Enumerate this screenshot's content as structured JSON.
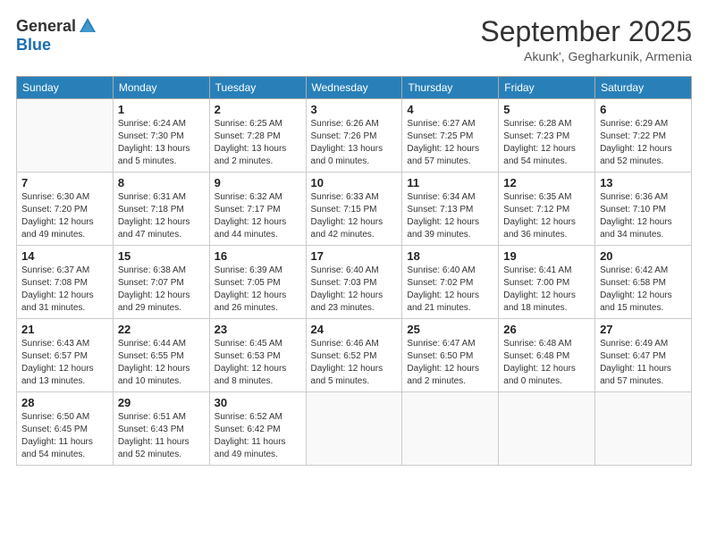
{
  "header": {
    "logo_general": "General",
    "logo_blue": "Blue",
    "month_title": "September 2025",
    "location": "Akunk', Gegharkunik, Armenia"
  },
  "days_of_week": [
    "Sunday",
    "Monday",
    "Tuesday",
    "Wednesday",
    "Thursday",
    "Friday",
    "Saturday"
  ],
  "weeks": [
    [
      {
        "day": "",
        "detail": ""
      },
      {
        "day": "1",
        "detail": "Sunrise: 6:24 AM\nSunset: 7:30 PM\nDaylight: 13 hours\nand 5 minutes."
      },
      {
        "day": "2",
        "detail": "Sunrise: 6:25 AM\nSunset: 7:28 PM\nDaylight: 13 hours\nand 2 minutes."
      },
      {
        "day": "3",
        "detail": "Sunrise: 6:26 AM\nSunset: 7:26 PM\nDaylight: 13 hours\nand 0 minutes."
      },
      {
        "day": "4",
        "detail": "Sunrise: 6:27 AM\nSunset: 7:25 PM\nDaylight: 12 hours\nand 57 minutes."
      },
      {
        "day": "5",
        "detail": "Sunrise: 6:28 AM\nSunset: 7:23 PM\nDaylight: 12 hours\nand 54 minutes."
      },
      {
        "day": "6",
        "detail": "Sunrise: 6:29 AM\nSunset: 7:22 PM\nDaylight: 12 hours\nand 52 minutes."
      }
    ],
    [
      {
        "day": "7",
        "detail": "Sunrise: 6:30 AM\nSunset: 7:20 PM\nDaylight: 12 hours\nand 49 minutes."
      },
      {
        "day": "8",
        "detail": "Sunrise: 6:31 AM\nSunset: 7:18 PM\nDaylight: 12 hours\nand 47 minutes."
      },
      {
        "day": "9",
        "detail": "Sunrise: 6:32 AM\nSunset: 7:17 PM\nDaylight: 12 hours\nand 44 minutes."
      },
      {
        "day": "10",
        "detail": "Sunrise: 6:33 AM\nSunset: 7:15 PM\nDaylight: 12 hours\nand 42 minutes."
      },
      {
        "day": "11",
        "detail": "Sunrise: 6:34 AM\nSunset: 7:13 PM\nDaylight: 12 hours\nand 39 minutes."
      },
      {
        "day": "12",
        "detail": "Sunrise: 6:35 AM\nSunset: 7:12 PM\nDaylight: 12 hours\nand 36 minutes."
      },
      {
        "day": "13",
        "detail": "Sunrise: 6:36 AM\nSunset: 7:10 PM\nDaylight: 12 hours\nand 34 minutes."
      }
    ],
    [
      {
        "day": "14",
        "detail": "Sunrise: 6:37 AM\nSunset: 7:08 PM\nDaylight: 12 hours\nand 31 minutes."
      },
      {
        "day": "15",
        "detail": "Sunrise: 6:38 AM\nSunset: 7:07 PM\nDaylight: 12 hours\nand 29 minutes."
      },
      {
        "day": "16",
        "detail": "Sunrise: 6:39 AM\nSunset: 7:05 PM\nDaylight: 12 hours\nand 26 minutes."
      },
      {
        "day": "17",
        "detail": "Sunrise: 6:40 AM\nSunset: 7:03 PM\nDaylight: 12 hours\nand 23 minutes."
      },
      {
        "day": "18",
        "detail": "Sunrise: 6:40 AM\nSunset: 7:02 PM\nDaylight: 12 hours\nand 21 minutes."
      },
      {
        "day": "19",
        "detail": "Sunrise: 6:41 AM\nSunset: 7:00 PM\nDaylight: 12 hours\nand 18 minutes."
      },
      {
        "day": "20",
        "detail": "Sunrise: 6:42 AM\nSunset: 6:58 PM\nDaylight: 12 hours\nand 15 minutes."
      }
    ],
    [
      {
        "day": "21",
        "detail": "Sunrise: 6:43 AM\nSunset: 6:57 PM\nDaylight: 12 hours\nand 13 minutes."
      },
      {
        "day": "22",
        "detail": "Sunrise: 6:44 AM\nSunset: 6:55 PM\nDaylight: 12 hours\nand 10 minutes."
      },
      {
        "day": "23",
        "detail": "Sunrise: 6:45 AM\nSunset: 6:53 PM\nDaylight: 12 hours\nand 8 minutes."
      },
      {
        "day": "24",
        "detail": "Sunrise: 6:46 AM\nSunset: 6:52 PM\nDaylight: 12 hours\nand 5 minutes."
      },
      {
        "day": "25",
        "detail": "Sunrise: 6:47 AM\nSunset: 6:50 PM\nDaylight: 12 hours\nand 2 minutes."
      },
      {
        "day": "26",
        "detail": "Sunrise: 6:48 AM\nSunset: 6:48 PM\nDaylight: 12 hours\nand 0 minutes."
      },
      {
        "day": "27",
        "detail": "Sunrise: 6:49 AM\nSunset: 6:47 PM\nDaylight: 11 hours\nand 57 minutes."
      }
    ],
    [
      {
        "day": "28",
        "detail": "Sunrise: 6:50 AM\nSunset: 6:45 PM\nDaylight: 11 hours\nand 54 minutes."
      },
      {
        "day": "29",
        "detail": "Sunrise: 6:51 AM\nSunset: 6:43 PM\nDaylight: 11 hours\nand 52 minutes."
      },
      {
        "day": "30",
        "detail": "Sunrise: 6:52 AM\nSunset: 6:42 PM\nDaylight: 11 hours\nand 49 minutes."
      },
      {
        "day": "",
        "detail": ""
      },
      {
        "day": "",
        "detail": ""
      },
      {
        "day": "",
        "detail": ""
      },
      {
        "day": "",
        "detail": ""
      }
    ]
  ]
}
